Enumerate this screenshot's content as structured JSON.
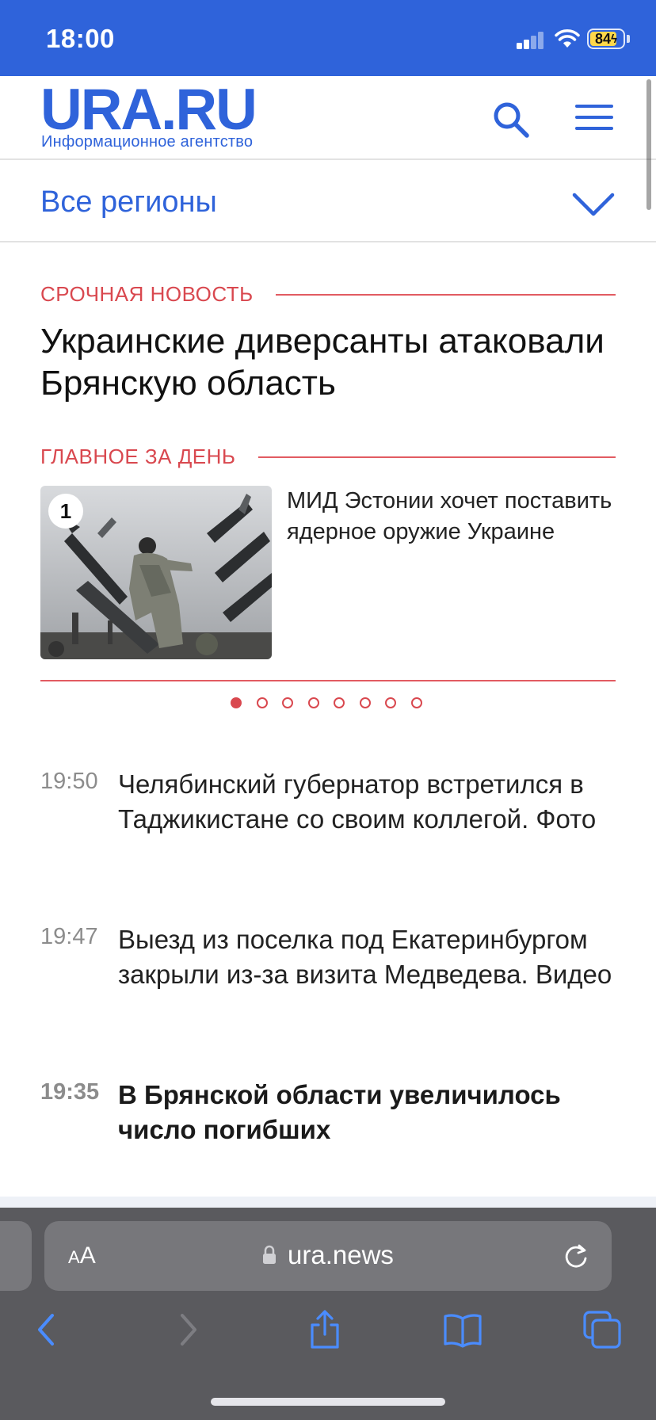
{
  "status_bar": {
    "time": "18:00",
    "battery_label": "84",
    "battery_level_percent": 84,
    "battery_color": "#ffd84a",
    "background": "#2f63da",
    "icons": [
      "signal-icon",
      "wifi-icon",
      "battery-icon"
    ]
  },
  "header": {
    "logo": "URA.RU",
    "tagline": "Информационное агентство",
    "icons": [
      "search-icon",
      "menu-icon"
    ],
    "brand_color": "#2f63da"
  },
  "region": {
    "label": "Все регионы",
    "icon": "chevron-down-icon"
  },
  "breaking": {
    "section_label": "СРОЧНАЯ НОВОСТЬ",
    "title": "Украинские диверсанты атаковали Брянскую область",
    "accent_color": "#d9484f"
  },
  "main_of_day": {
    "section_label": "ГЛАВНОЕ ЗА ДЕНЬ",
    "card": {
      "rank": "1",
      "title": "МИД Эстонии хочет поставить ядерное оружие Украине",
      "image": "photo of soldier loading missiles"
    },
    "pagination": {
      "total": 8,
      "active_index": 0
    }
  },
  "news": [
    {
      "time": "19:50",
      "title": "Челябинский губернатор встретился в Таджикистане со своим коллегой. Фото",
      "bold": false
    },
    {
      "time": "19:47",
      "title": "Выезд из поселка под Екатеринбургом закрыли из-за визита Медведева. Видео",
      "bold": false
    },
    {
      "time": "19:35",
      "title": "В Брянской области увеличилось число погибших",
      "bold": true
    }
  ],
  "browser": {
    "text_size_label_small": "A",
    "text_size_label_large": "A",
    "url": "ura.news",
    "icons": [
      "lock-icon",
      "reload-icon"
    ],
    "toolbar": [
      {
        "name": "back-button",
        "icon": "chevron-left-icon",
        "enabled": true
      },
      {
        "name": "forward-button",
        "icon": "chevron-right-icon",
        "enabled": false
      },
      {
        "name": "share-button",
        "icon": "share-icon",
        "enabled": true
      },
      {
        "name": "bookmarks-button",
        "icon": "book-icon",
        "enabled": true
      },
      {
        "name": "tabs-button",
        "icon": "tabs-icon",
        "enabled": true
      }
    ],
    "tint_color": "#4a8cff"
  }
}
